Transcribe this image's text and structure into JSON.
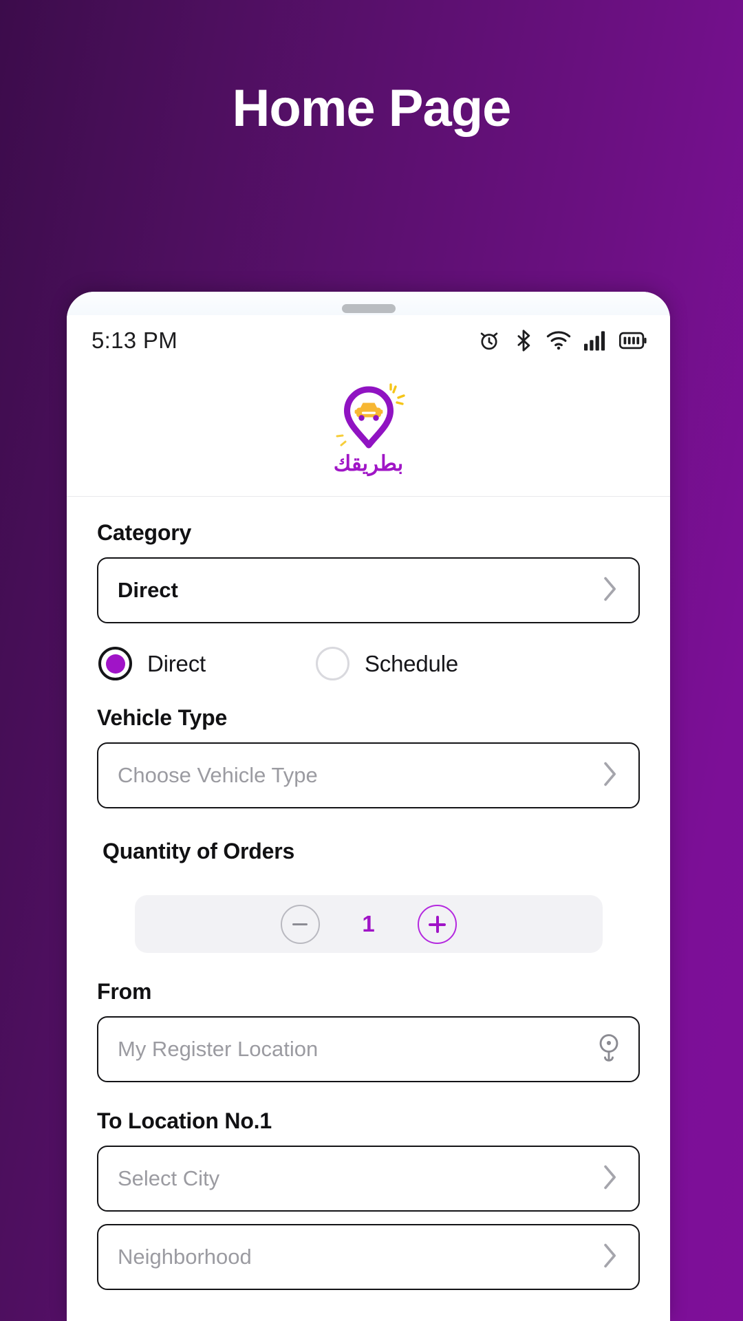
{
  "page": {
    "title": "Home Page",
    "accent_purple": "#a014c7",
    "bg_gradient_from": "#3c0c4b",
    "bg_gradient_to": "#7e0f99"
  },
  "status_bar": {
    "time": "5:13 PM",
    "icons": [
      "alarm-icon",
      "bluetooth-icon",
      "wifi-icon",
      "cellular-signal-icon",
      "battery-icon"
    ]
  },
  "app_header": {
    "logo_icon": "map-pin-car-logo",
    "logo_wordmark": "بطريقك"
  },
  "form": {
    "category": {
      "label": "Category",
      "value": "Direct",
      "chevron": "chevron-right-icon"
    },
    "delivery_mode": {
      "options": [
        {
          "label": "Direct",
          "selected": true
        },
        {
          "label": "Schedule",
          "selected": false
        }
      ]
    },
    "vehicle_type": {
      "label": "Vehicle Type",
      "placeholder": "Choose Vehicle Type",
      "value": "",
      "chevron": "chevron-right-icon"
    },
    "quantity": {
      "label": "Quantity of Orders",
      "value": "1",
      "decrement_label": "−",
      "increment_label": "+"
    },
    "from": {
      "label": "From",
      "placeholder": "My Register Location",
      "value": "",
      "icon": "location-pin-icon"
    },
    "to_location_1": {
      "label": "To Location No.1",
      "city_placeholder": "Select City",
      "city_value": "",
      "neighborhood_placeholder": "Neighborhood",
      "neighborhood_value": "",
      "chevron": "chevron-right-icon"
    }
  }
}
